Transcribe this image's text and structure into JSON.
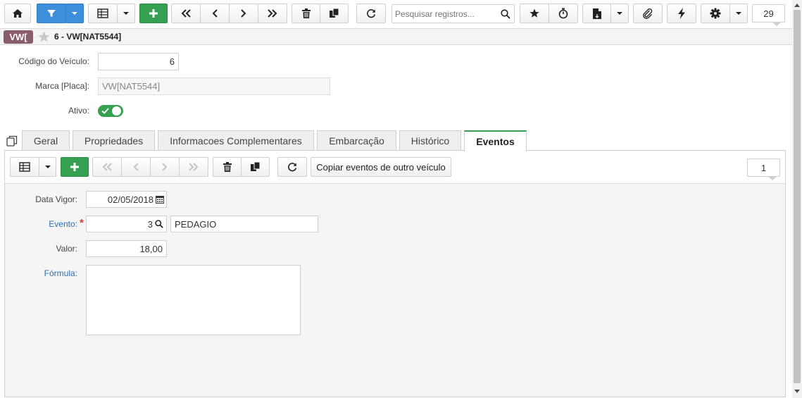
{
  "toolbar": {
    "search_placeholder": "Pesquisar registros...",
    "record_count": "29"
  },
  "header": {
    "badge": "VW[",
    "title": "6 - VW[NAT5544]"
  },
  "form": {
    "codigo_label": "Código do Veículo:",
    "codigo_value": "6",
    "marca_label": "Marca [Placa]:",
    "marca_value": "VW[NAT5544]",
    "ativo_label": "Ativo:"
  },
  "tabs": [
    {
      "label": "Geral"
    },
    {
      "label": "Propriedades"
    },
    {
      "label": "Informacoes Complementares"
    },
    {
      "label": "Embarcação"
    },
    {
      "label": "Histórico"
    },
    {
      "label": "Eventos"
    }
  ],
  "subtoolbar": {
    "copy_label": "Copiar eventos de outro veículo",
    "count": "1"
  },
  "detail": {
    "data_vigor_label": "Data Vigor:",
    "data_vigor_value": "02/05/2018",
    "evento_label": "Evento:",
    "required_mark": "*",
    "evento_code": "3",
    "evento_name": "PEDAGIO",
    "valor_label": "Valor:",
    "valor_value": "18,00",
    "formula_label": "Fórmula:",
    "formula_value": ""
  },
  "colors": {
    "primary": "#3d8fd9",
    "success": "#34a050",
    "badge": "#8a5d6e",
    "required": "#d9342b"
  }
}
